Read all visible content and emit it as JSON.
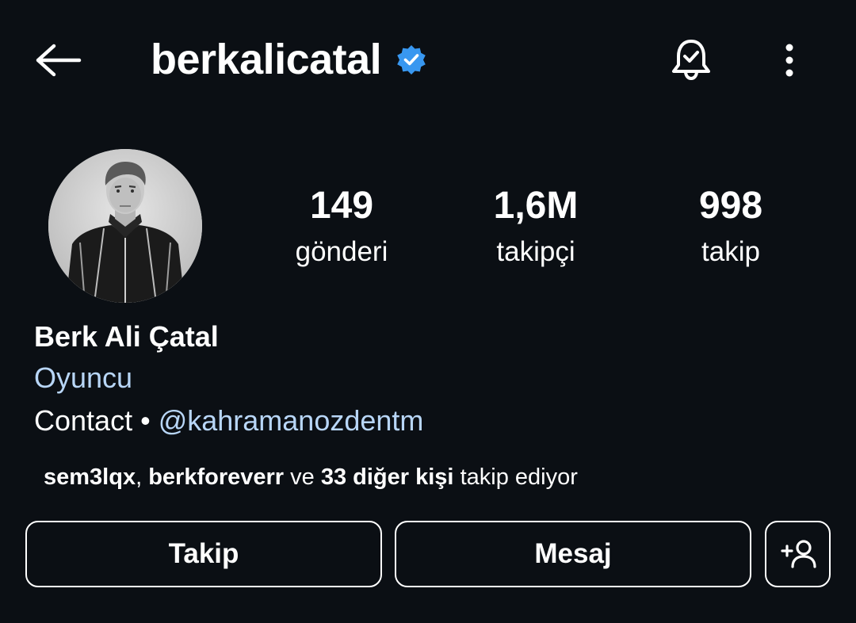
{
  "header": {
    "username": "berkalicatal",
    "back_icon": "arrow-left-icon",
    "verified_icon": "verified-badge-icon",
    "verified_color": "#3897f0",
    "bell_icon": "bell-check-icon",
    "more_icon": "more-vertical-icon"
  },
  "profile": {
    "avatar_icon": "profile-photo",
    "stats": [
      {
        "value": "149",
        "label": "gönderi"
      },
      {
        "value": "1,6M",
        "label": "takipçi"
      },
      {
        "value": "998",
        "label": "takip"
      }
    ],
    "full_name": "Berk Ali Çatal",
    "category": "Oyuncu",
    "contact_prefix": "Contact •",
    "contact_link": "@kahramanozdentm",
    "link_color": "#b8d6f7",
    "followed_by": {
      "user1": "sem3lqx",
      "separator": ",",
      "user2": "berkforeverr",
      "and": "ve",
      "others": "33 diğer kişi",
      "suffix": "takip ediyor"
    }
  },
  "actions": {
    "follow_label": "Takip",
    "message_label": "Mesaj",
    "add_user_icon": "add-user-icon"
  },
  "colors": {
    "background": "#0b0f14",
    "text": "#ffffff"
  }
}
